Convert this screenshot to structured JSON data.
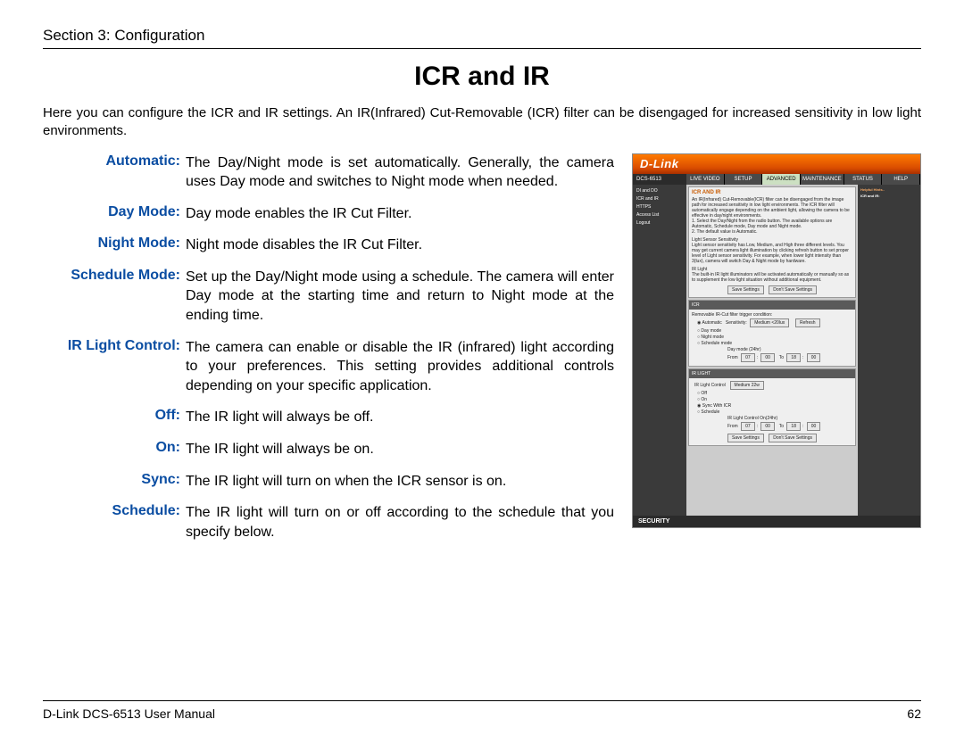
{
  "section_header": "Section 3: Configuration",
  "page_title": "ICR and IR",
  "intro": "Here you can configure the ICR and IR settings. An IR(Infrared) Cut-Removable (ICR) filter can be disengaged for increased sensitivity in low light environments.",
  "defs": [
    {
      "label": "Automatic:",
      "desc": "The Day/Night mode is set automatically. Generally, the camera uses Day mode and switches to Night mode when needed."
    },
    {
      "label": "Day Mode:",
      "desc": "Day mode enables the IR Cut Filter."
    },
    {
      "label": "Night Mode:",
      "desc": "Night mode disables the IR Cut Filter."
    },
    {
      "label": "Schedule Mode:",
      "desc": "Set up the Day/Night mode using a schedule. The camera will enter Day mode at the starting time and return to Night mode at the ending time."
    },
    {
      "label": "IR Light Control:",
      "desc": "The camera can enable or disable the IR (infrared) light according to your preferences. This setting provides additional controls depending on your specific application."
    },
    {
      "label": "Off:",
      "desc": "The IR light will always be off."
    },
    {
      "label": "On:",
      "desc": "The IR light will always be on."
    },
    {
      "label": "Sync:",
      "desc": "The IR light will turn on when the ICR sensor is on."
    },
    {
      "label": "Schedule:",
      "desc": "The IR light will turn on or off according to the schedule that you specify below."
    }
  ],
  "screenshot": {
    "brand": "D-Link",
    "model": "DCS-6513",
    "tabs": [
      "LIVE VIDEO",
      "SETUP",
      "ADVANCED",
      "MAINTENANCE",
      "STATUS",
      "HELP"
    ],
    "active_tab": "ADVANCED",
    "sidenav": [
      "DI and DO",
      "ICR and IR",
      "HTTPS",
      "Access List",
      "Logout"
    ],
    "help_title": "Helpful Hints..",
    "help_heading": "ICR and IR:",
    "panel1": {
      "title": "ICR AND IR",
      "body": "An IR(Infrared) Cut-Removable(ICR) filter can be disengaged from the image path for increased sensitivity in low light environments. The ICR filter will automatically engage depending on the ambient light, allowing the camera to be effective in day/night environments.\n1. Select the Day/Night from the radio button. The available options are Automatic, Schedule mode, Day mode and Night mode.\n2. The default value is Automatic.",
      "ls_heading": "Light Sensor Sensitivity",
      "ls_body": "Light sensor sensitivity has Low, Medium, and High three different levels. You may get current camera light illumination by clicking refresh button to set proper level of Light sensor sensitivity. For example, when lower light intensity than 3(lux), camera will switch Day & Night mode by hardware.",
      "ir_heading": "IR Light",
      "ir_body": "The built-in IR light illuminators will be activated automatically or manually so as to supplement the low light situation without additional equipment.",
      "save": "Save Settings",
      "dont_save": "Don't Save Settings"
    },
    "panel_icr": {
      "title": "ICR",
      "cond": "Removable IR-Cut filter trigger condition:",
      "opts": [
        "Automatic",
        "Day mode",
        "Night mode",
        "Schedule mode"
      ],
      "sens_label": "Sensitivity:",
      "sens_value": "Medium <20lux",
      "refresh": "Refresh",
      "sched_label": "Day mode (24hr)",
      "from": "From",
      "from_h": "07",
      "from_m": "00",
      "to": "To",
      "to_h": "18",
      "to_m": "00"
    },
    "panel_irlight": {
      "title": "IR LIGHT",
      "ctrl_label": "IR Light Control",
      "ctrl_value": "Medium 22w",
      "opts": [
        "Off",
        "On",
        "Sync With ICR",
        "Schedule"
      ],
      "sched_label": "IR Light Control On(24hr)",
      "from": "From",
      "from_h": "07",
      "from_m": "00",
      "to": "To",
      "to_h": "18",
      "to_m": "00",
      "save": "Save Settings",
      "dont_save": "Don't Save Settings"
    },
    "footer": "SECURITY"
  },
  "footer_left": "D-Link DCS-6513 User Manual",
  "footer_right": "62"
}
